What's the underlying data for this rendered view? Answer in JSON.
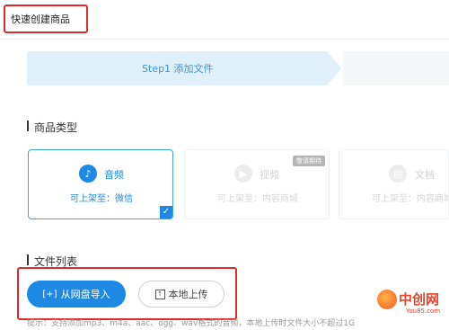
{
  "header": {
    "title": "快速创建商品"
  },
  "step": {
    "label": "Step1 添加文件"
  },
  "product_type": {
    "title": "商品类型",
    "cards": [
      {
        "name": "音频",
        "sub": "可上架至：微信",
        "icon": "music-note-icon",
        "selected": true
      },
      {
        "name": "视频",
        "sub": "可上架至：内容商城",
        "icon": "video-icon",
        "selected": false,
        "badge": "敬请期待"
      },
      {
        "name": "文档",
        "sub": "可上架至：内容商城",
        "icon": "document-icon",
        "selected": false
      }
    ]
  },
  "files": {
    "title": "文件列表",
    "import_label": "从网盘导入",
    "upload_label": "本地上传",
    "hint": "提示：支持添加mp3、m4a、aac、ogg、wav格式的音频，本地上传时文件大小不超过1G"
  },
  "watermark": {
    "text": "中创网",
    "sub": "You85.com"
  },
  "colors": {
    "accent": "#1e88e5",
    "highlight": "#e02b2b",
    "step_bg": "#dff0fa"
  }
}
